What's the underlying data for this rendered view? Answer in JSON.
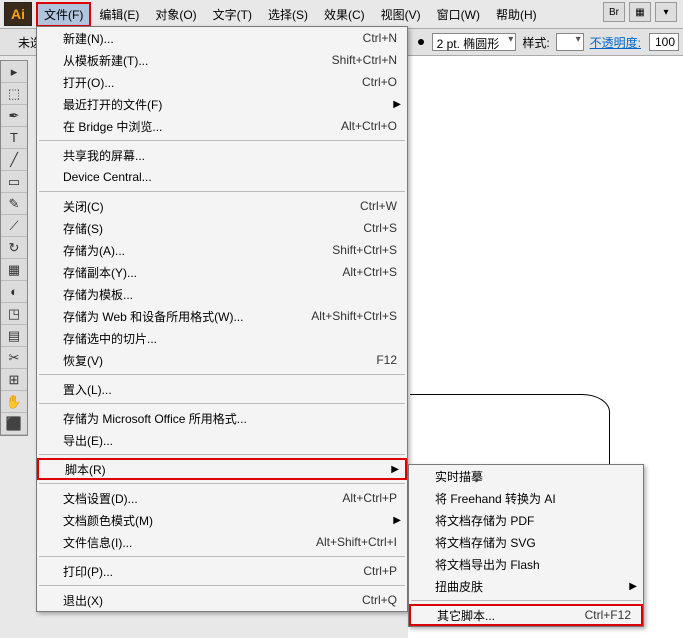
{
  "brand": "Ai",
  "menubar": [
    "文件(F)",
    "编辑(E)",
    "对象(O)",
    "文字(T)",
    "选择(S)",
    "效果(C)",
    "视图(V)",
    "窗口(W)",
    "帮助(H)"
  ],
  "miniBtns": [
    "Br",
    "▦",
    "▾"
  ],
  "toolbar": {
    "unsel": "未选",
    "stroke": "2 pt. 椭圆形",
    "styleLabel": "样式:",
    "opacityLabel": "不透明度:",
    "opacityVal": "100"
  },
  "menu": [
    {
      "label": "新建(N)...",
      "sc": "Ctrl+N"
    },
    {
      "label": "从模板新建(T)...",
      "sc": "Shift+Ctrl+N"
    },
    {
      "label": "打开(O)...",
      "sc": "Ctrl+O"
    },
    {
      "label": "最近打开的文件(F)",
      "arrow": true
    },
    {
      "label": "在 Bridge 中浏览...",
      "sc": "Alt+Ctrl+O"
    },
    {
      "sep": true
    },
    {
      "label": "共享我的屏幕..."
    },
    {
      "label": "Device Central..."
    },
    {
      "sep": true
    },
    {
      "label": "关闭(C)",
      "sc": "Ctrl+W"
    },
    {
      "label": "存储(S)",
      "sc": "Ctrl+S"
    },
    {
      "label": "存储为(A)...",
      "sc": "Shift+Ctrl+S"
    },
    {
      "label": "存储副本(Y)...",
      "sc": "Alt+Ctrl+S"
    },
    {
      "label": "存储为模板..."
    },
    {
      "label": "存储为 Web 和设备所用格式(W)...",
      "sc": "Alt+Shift+Ctrl+S"
    },
    {
      "label": "存储选中的切片..."
    },
    {
      "label": "恢复(V)",
      "sc": "F12"
    },
    {
      "sep": true
    },
    {
      "label": "置入(L)..."
    },
    {
      "sep": true
    },
    {
      "label": "存储为 Microsoft Office 所用格式..."
    },
    {
      "label": "导出(E)..."
    },
    {
      "sep": true
    },
    {
      "label": "脚本(R)",
      "arrow": true,
      "hl": true
    },
    {
      "sep": true
    },
    {
      "label": "文档设置(D)...",
      "sc": "Alt+Ctrl+P"
    },
    {
      "label": "文档颜色模式(M)",
      "arrow": true
    },
    {
      "label": "文件信息(I)...",
      "sc": "Alt+Shift+Ctrl+I"
    },
    {
      "sep": true
    },
    {
      "label": "打印(P)...",
      "sc": "Ctrl+P"
    },
    {
      "sep": true
    },
    {
      "label": "退出(X)",
      "sc": "Ctrl+Q"
    }
  ],
  "submenu": [
    {
      "label": "实时描摹"
    },
    {
      "label": "将 Freehand 转换为 AI"
    },
    {
      "label": "将文档存储为 PDF"
    },
    {
      "label": "将文档存储为 SVG"
    },
    {
      "label": "将文档导出为 Flash"
    },
    {
      "label": "扭曲皮肤",
      "arrow": true
    },
    {
      "sep": true
    },
    {
      "label": "其它脚本...",
      "sc": "Ctrl+F12",
      "hl": true
    }
  ],
  "tools": [
    "▸",
    "⬚",
    "✒",
    "T",
    "╱",
    "▭",
    "✎",
    "⟋",
    "↻",
    "▦",
    "◐",
    "◳",
    "▤",
    "✂",
    "⊞",
    "✋",
    "⬛"
  ]
}
